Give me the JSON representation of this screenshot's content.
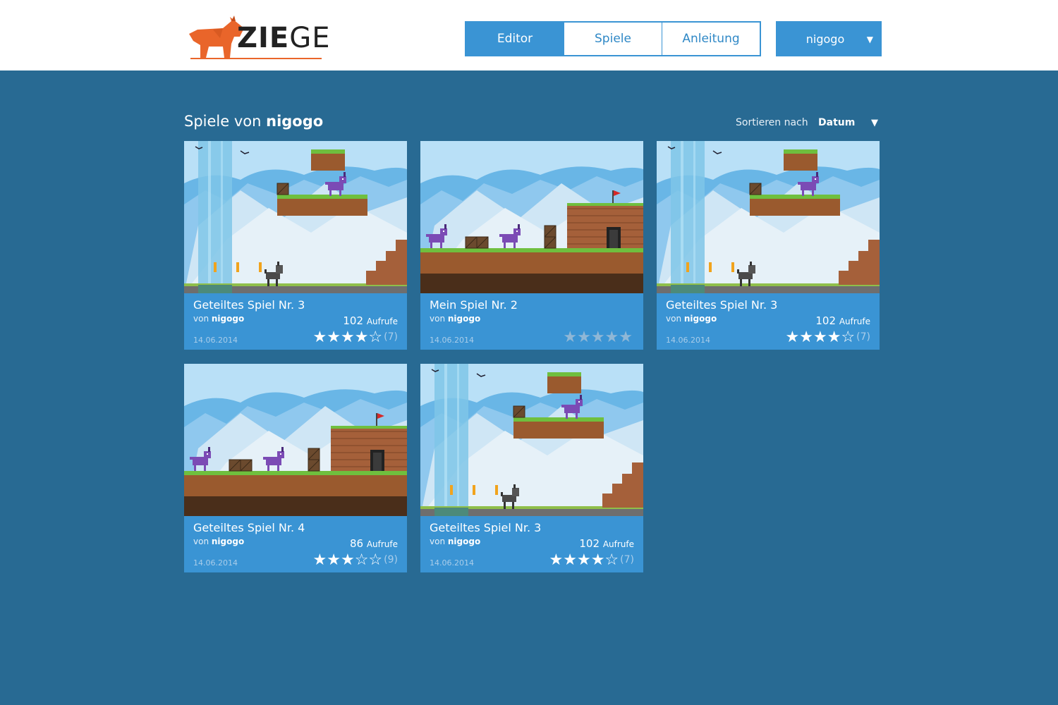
{
  "header": {
    "logo_text_bold": "ZIE",
    "logo_text_light": "GE",
    "nav": [
      {
        "label": "Editor",
        "active": true
      },
      {
        "label": "Spiele",
        "active": false
      },
      {
        "label": "Anleitung",
        "active": false
      }
    ],
    "user": {
      "name": "nigogo",
      "caret": "▼"
    }
  },
  "main": {
    "heading_prefix": "Spiele von",
    "heading_user": "nigogo",
    "sort_label": "Sortieren nach",
    "sort_value": "Datum",
    "sort_caret": "▼"
  },
  "games": [
    {
      "title": "Geteiltes Spiel Nr. 3",
      "by_prefix": "von",
      "author": "nigogo",
      "views": "102",
      "views_label": "Aufrufe",
      "date": "14.06.2014",
      "stars": "★★★★☆",
      "rating_count": "(7)",
      "rating_value": 4,
      "scene": "cliff"
    },
    {
      "title": "Mein Spiel Nr. 2",
      "by_prefix": "von",
      "author": "nigogo",
      "views": "",
      "views_label": "",
      "date": "14.06.2014",
      "stars": "★★★★★",
      "rating_count": "",
      "rating_value": 0,
      "scene": "house"
    },
    {
      "title": "Geteiltes Spiel Nr. 3",
      "by_prefix": "von",
      "author": "nigogo",
      "views": "102",
      "views_label": "Aufrufe",
      "date": "14.06.2014",
      "stars": "★★★★☆",
      "rating_count": "(7)",
      "rating_value": 4,
      "scene": "cliff"
    },
    {
      "title": "Geteiltes Spiel Nr. 4",
      "by_prefix": "von",
      "author": "nigogo",
      "views": "86",
      "views_label": "Aufrufe",
      "date": "14.06.2014",
      "stars": "★★★☆☆",
      "rating_count": "(9)",
      "rating_value": 3,
      "scene": "house"
    },
    {
      "title": "Geteiltes Spiel Nr. 3",
      "by_prefix": "von",
      "author": "nigogo",
      "views": "102",
      "views_label": "Aufrufe",
      "date": "14.06.2014",
      "stars": "★★★★☆",
      "rating_count": "(7)",
      "rating_value": 4,
      "scene": "cliff"
    }
  ],
  "colors": {
    "background": "#286a93",
    "accent": "#3a94d4",
    "logo_orange": "#e9652a"
  }
}
